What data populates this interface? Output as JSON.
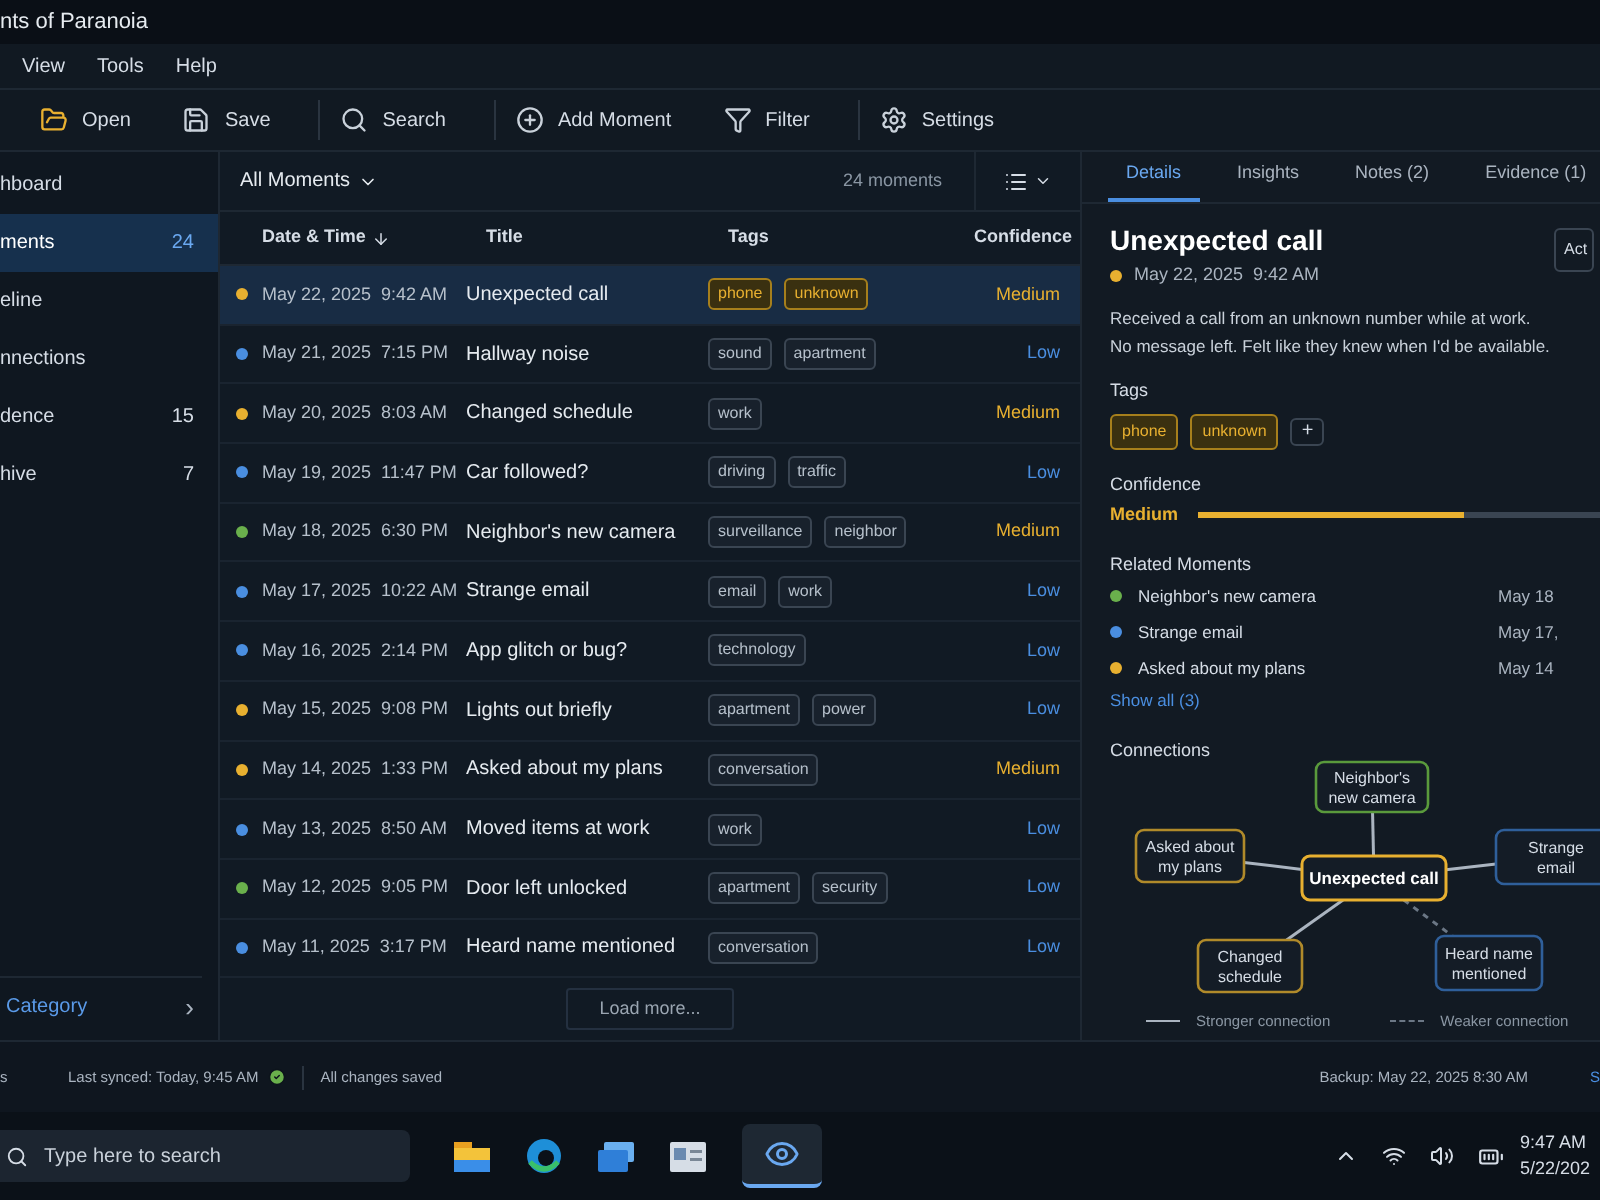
{
  "window": {
    "title": "nts of Paranoia"
  },
  "menu": [
    "View",
    "Tools",
    "Help"
  ],
  "toolbar": [
    {
      "kind": "open",
      "label": "Open"
    },
    {
      "kind": "save",
      "label": "Save"
    },
    {
      "kind": "search",
      "label": "Search"
    },
    {
      "kind": "add",
      "label": "Add Moment"
    },
    {
      "kind": "filter",
      "label": "Filter"
    },
    {
      "kind": "settings",
      "label": "Settings"
    }
  ],
  "sidebar": {
    "items": [
      {
        "label": "hboard",
        "selected": false
      },
      {
        "label": "ments",
        "count": "24",
        "selected": true
      },
      {
        "label": "eline",
        "selected": false
      },
      {
        "label": "nnections",
        "selected": false
      },
      {
        "label": "dence",
        "count": "15",
        "selected": false
      },
      {
        "label": "hive",
        "count": "7",
        "selected": false
      }
    ],
    "footer": {
      "label": "Category",
      "chevron": "›"
    }
  },
  "list": {
    "view": "All Moments",
    "count": "24 moments",
    "columns": [
      "Date & Time",
      "Title",
      "Tags",
      "Confidence"
    ],
    "rows": [
      {
        "selected": true,
        "color": "#e8b030",
        "date": "May 22, 2025  9:42 AM",
        "title": "Unexpected call",
        "tags": [
          "phone",
          "unknown"
        ],
        "confidence": {
          "text": "Medium",
          "color": "#e8b030"
        }
      },
      {
        "selected": false,
        "color": "#4a8ee0",
        "date": "May 21, 2025  7:15 PM",
        "title": "Hallway noise",
        "tags": [
          "sound",
          "apartment"
        ],
        "confidence": {
          "text": "Low",
          "color": "#4a8ee0"
        }
      },
      {
        "selected": false,
        "color": "#e8b030",
        "date": "May 20, 2025  8:03 AM",
        "title": "Changed schedule",
        "tags": [
          "work"
        ],
        "confidence": {
          "text": "Medium",
          "color": "#e8b030"
        }
      },
      {
        "selected": false,
        "color": "#4a8ee0",
        "date": "May 19, 2025  11:47 PM",
        "title": "Car followed?",
        "tags": [
          "driving",
          "traffic"
        ],
        "confidence": {
          "text": "Low",
          "color": "#4a8ee0"
        }
      },
      {
        "selected": false,
        "color": "#6ab04c",
        "date": "May 18, 2025  6:30 PM",
        "title": "Neighbor's new camera",
        "tags": [
          "surveillance",
          "neighbor"
        ],
        "confidence": {
          "text": "Medium",
          "color": "#e8b030"
        }
      },
      {
        "selected": false,
        "color": "#4a8ee0",
        "date": "May 17, 2025  10:22 AM",
        "title": "Strange email",
        "tags": [
          "email",
          "work"
        ],
        "confidence": {
          "text": "Low",
          "color": "#4a8ee0"
        }
      },
      {
        "selected": false,
        "color": "#4a8ee0",
        "date": "May 16, 2025  2:14 PM",
        "title": "App glitch or bug?",
        "tags": [
          "technology"
        ],
        "confidence": {
          "text": "Low",
          "color": "#4a8ee0"
        }
      },
      {
        "selected": false,
        "color": "#e8b030",
        "date": "May 15, 2025  9:08 PM",
        "title": "Lights out briefly",
        "tags": [
          "apartment",
          "power"
        ],
        "confidence": {
          "text": "Low",
          "color": "#4a8ee0"
        }
      },
      {
        "selected": false,
        "color": "#e8b030",
        "date": "May 14, 2025  1:33 PM",
        "title": "Asked about my plans",
        "tags": [
          "conversation"
        ],
        "confidence": {
          "text": "Medium",
          "color": "#e8b030"
        }
      },
      {
        "selected": false,
        "color": "#4a8ee0",
        "date": "May 13, 2025  8:50 AM",
        "title": "Moved items at work",
        "tags": [
          "work"
        ],
        "confidence": {
          "text": "Low",
          "color": "#4a8ee0"
        }
      },
      {
        "selected": false,
        "color": "#6ab04c",
        "date": "May 12, 2025  9:05 PM",
        "title": "Door left unlocked",
        "tags": [
          "apartment",
          "security"
        ],
        "confidence": {
          "text": "Low",
          "color": "#4a8ee0"
        }
      },
      {
        "selected": false,
        "color": "#4a8ee0",
        "date": "May 11, 2025  3:17 PM",
        "title": "Heard name mentioned",
        "tags": [
          "conversation"
        ],
        "confidence": {
          "text": "Low",
          "color": "#4a8ee0"
        }
      }
    ],
    "load_more": "Load more..."
  },
  "details": {
    "tabs": [
      {
        "label": "Details",
        "selected": true
      },
      {
        "label": "Insights",
        "selected": false
      },
      {
        "label": "Notes (2)",
        "selected": false
      },
      {
        "label": "Evidence (1)",
        "selected": false
      }
    ],
    "title": "Unexpected call",
    "action": "Act",
    "color": "#e8b030",
    "date": "May 22, 2025  9:42 AM",
    "description": [
      "Received a call from an unknown number while at work.",
      "No message left. Felt like they knew when I'd be available."
    ],
    "tags_label": "Tags",
    "tags": [
      "phone",
      "unknown"
    ],
    "add_tag": "+",
    "confidence_label": "Confidence",
    "confidence": "Medium",
    "level": 0.6,
    "related_label": "Related Moments",
    "related": [
      {
        "title": "Neighbor's new camera",
        "date": "May 18",
        "color": "#6ab04c"
      },
      {
        "title": "Strange email",
        "date": "May 17, ",
        "color": "#4a8ee0"
      },
      {
        "title": "Asked about my plans",
        "date": "May 14",
        "color": "#e8b030"
      }
    ],
    "show_all": "Show all (3)",
    "connections_label": "Connections",
    "graph": {
      "center": "Unexpected call",
      "nodes": [
        {
          "lines": [
            "Neighbor's",
            "new camera"
          ],
          "color": "#5a9a3c",
          "kind": "strong"
        },
        {
          "lines": [
            "Asked about",
            "my plans"
          ],
          "color": "#b08a2a",
          "kind": "strong"
        },
        {
          "lines": [
            "Strange",
            "email"
          ],
          "color": "#2f5f9a",
          "kind": "strong"
        },
        {
          "lines": [
            "Changed",
            "schedule"
          ],
          "color": "#b08a2a",
          "kind": "strong"
        },
        {
          "lines": [
            "Heard name",
            "mentioned"
          ],
          "color": "#2f5f9a",
          "kind": "weak"
        }
      ]
    },
    "legend": [
      {
        "kind": "strong",
        "label": "Stronger connection"
      },
      {
        "kind": "weak",
        "label": "Weaker connection"
      }
    ]
  },
  "status_bar": {
    "left": "s",
    "synced": "Last synced: Today, 9:45 AM",
    "saved": "All changes saved",
    "backup": "Backup: May 22, 2025 8:30 AM",
    "right": "S"
  },
  "taskbar": {
    "search_placeholder": "Type here to search",
    "time": "9:47 AM",
    "date": "5/22/202"
  }
}
